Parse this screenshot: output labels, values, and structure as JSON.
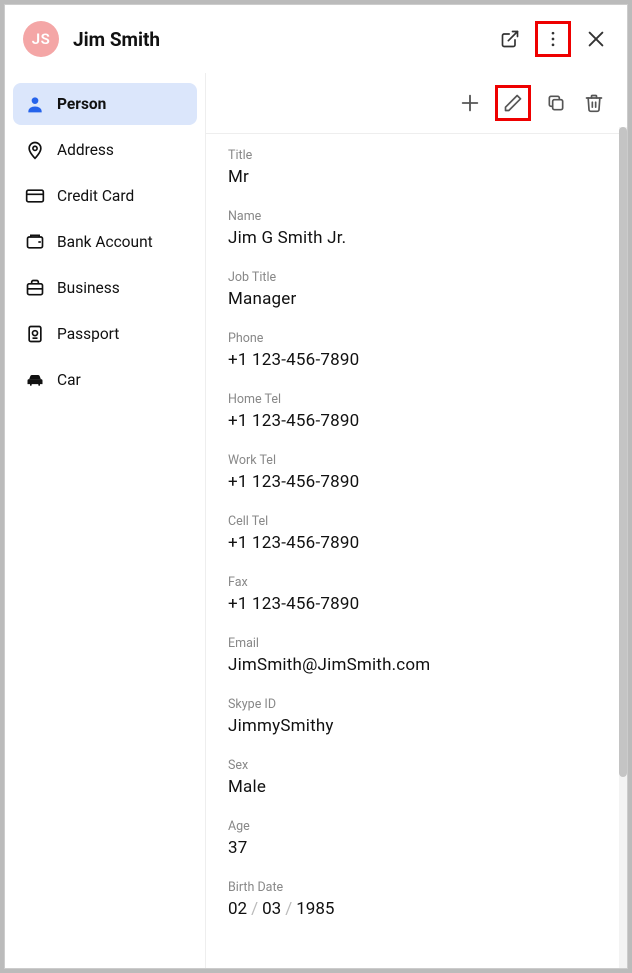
{
  "header": {
    "avatar_initials": "JS",
    "title": "Jim Smith"
  },
  "sidebar": {
    "items": [
      {
        "label": "Person",
        "active": true
      },
      {
        "label": "Address",
        "active": false
      },
      {
        "label": "Credit Card",
        "active": false
      },
      {
        "label": "Bank Account",
        "active": false
      },
      {
        "label": "Business",
        "active": false
      },
      {
        "label": "Passport",
        "active": false
      },
      {
        "label": "Car",
        "active": false
      }
    ]
  },
  "fields": {
    "title_label": "Title",
    "title_value": "Mr",
    "name_label": "Name",
    "name_value": "Jim  G  Smith  Jr.",
    "job_label": "Job Title",
    "job_value": "Manager",
    "phone_label": "Phone",
    "phone_value": "+1 123-456-7890",
    "home_label": "Home Tel",
    "home_value": "+1 123-456-7890",
    "work_label": "Work Tel",
    "work_value": "+1 123-456-7890",
    "cell_label": "Cell Tel",
    "cell_value": "+1 123-456-7890",
    "fax_label": "Fax",
    "fax_value": "+1 123-456-7890",
    "email_label": "Email",
    "email_value": "JimSmith@JimSmith.com",
    "skype_label": "Skype ID",
    "skype_value": "JimmySmithy",
    "sex_label": "Sex",
    "sex_value": "Male",
    "age_label": "Age",
    "age_value": "37",
    "birth_label": "Birth Date",
    "birth_dd": "02",
    "birth_mm": "03",
    "birth_yyyy": "1985"
  }
}
